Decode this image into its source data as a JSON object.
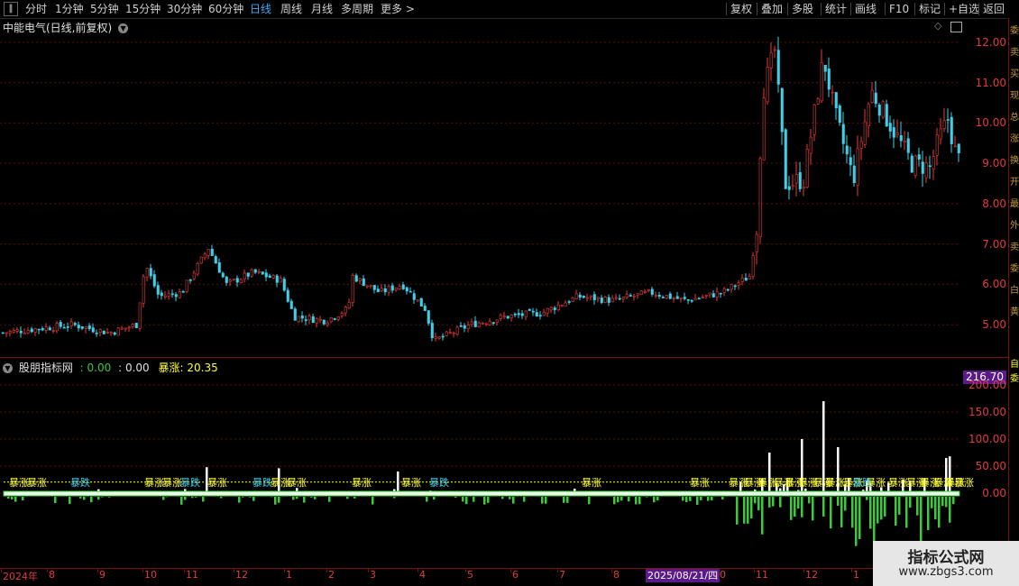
{
  "toolbar": {
    "back_glyph": "‖",
    "left_items": [
      "分时",
      "1分钟",
      "5分钟",
      "15分钟",
      "30分钟",
      "60分钟",
      "日线",
      "周线",
      "月线",
      "多周期",
      "更多 >"
    ],
    "active": "日线",
    "right_items": [
      "复权",
      "叠加",
      "多股",
      "统计",
      "画线",
      "F10",
      "标记",
      "+自选",
      "返回"
    ]
  },
  "main_pane": {
    "title": "中能电气(日线,前复权)",
    "price_axis": [
      "12.00",
      "11.00",
      "10.00",
      "9.00",
      "8.00",
      "7.00",
      "6.00",
      "5.00"
    ]
  },
  "indicator_pane": {
    "name": "股朋指标网",
    "v1_label": ":",
    "v1_value": "0.00",
    "v2_label": ":",
    "v2_value": "0.00",
    "v3_label": "暴涨:",
    "v3_value": "20.35",
    "max_label": "216.70",
    "axis": [
      "200.00",
      "150.00",
      "100.00",
      "50.00",
      "0.00"
    ],
    "signal_up_text": "暴涨",
    "signal_down_text": "暴跌"
  },
  "date_axis": {
    "labels": [
      "2024年",
      "8",
      "9",
      "10",
      "11",
      "12",
      "1",
      "2",
      "3",
      "4",
      "5",
      "6",
      "7",
      "8",
      "0",
      "11",
      "12",
      "1"
    ],
    "cursor_date": "2025/08/21/四"
  },
  "right_bar": {
    "chars": [
      "委",
      "卖",
      "买",
      "现",
      "总",
      "涨",
      "换",
      "开",
      "最",
      "外",
      "卖",
      "委",
      "白",
      "黄"
    ],
    "markers": [
      "自",
      "委"
    ]
  },
  "watermark": {
    "title": "指标公式网",
    "url": "www.zbgs3.com"
  },
  "colors": {
    "up": "#e83a3a",
    "down": "#3fd0e8",
    "grid": "#5a0f0f",
    "signal": "#ffff33",
    "bar_white": "#ffffff",
    "bar_green": "#3ec83e",
    "active_tab": "#3fa9f5",
    "badge": "#5a1a8a"
  },
  "chart_data": {
    "type": "candlestick",
    "title": "中能电气(日线,前复权)",
    "price_range": [
      4.2,
      12.6
    ],
    "approx_close_path": [
      [
        0,
        4.8
      ],
      [
        40,
        4.9
      ],
      [
        80,
        5.0
      ],
      [
        120,
        4.8
      ],
      [
        150,
        5.0
      ],
      [
        160,
        6.5
      ],
      [
        175,
        5.7
      ],
      [
        200,
        5.8
      ],
      [
        230,
        6.9
      ],
      [
        250,
        6.0
      ],
      [
        280,
        6.3
      ],
      [
        310,
        6.1
      ],
      [
        325,
        5.2
      ],
      [
        360,
        5.1
      ],
      [
        385,
        5.4
      ],
      [
        390,
        6.2
      ],
      [
        420,
        5.8
      ],
      [
        445,
        6.0
      ],
      [
        470,
        5.4
      ],
      [
        480,
        4.6
      ],
      [
        520,
        5.0
      ],
      [
        560,
        5.2
      ],
      [
        600,
        5.3
      ],
      [
        640,
        5.7
      ],
      [
        680,
        5.6
      ],
      [
        720,
        5.8
      ],
      [
        760,
        5.6
      ],
      [
        800,
        5.8
      ],
      [
        830,
        6.2
      ],
      [
        838,
        7.4
      ],
      [
        845,
        10.8
      ],
      [
        858,
        11.8
      ],
      [
        870,
        8.5
      ],
      [
        890,
        8.6
      ],
      [
        912,
        11.6
      ],
      [
        925,
        10.2
      ],
      [
        945,
        8.6
      ],
      [
        965,
        10.8
      ],
      [
        990,
        9.8
      ],
      [
        1010,
        9.0
      ],
      [
        1030,
        8.9
      ],
      [
        1040,
        9.6
      ],
      [
        1050,
        10.1
      ],
      [
        1060,
        9.1
      ]
    ],
    "indicator": {
      "series": [
        "暴涨"
      ],
      "max": 216.7,
      "signal_level": 20.35
    }
  }
}
